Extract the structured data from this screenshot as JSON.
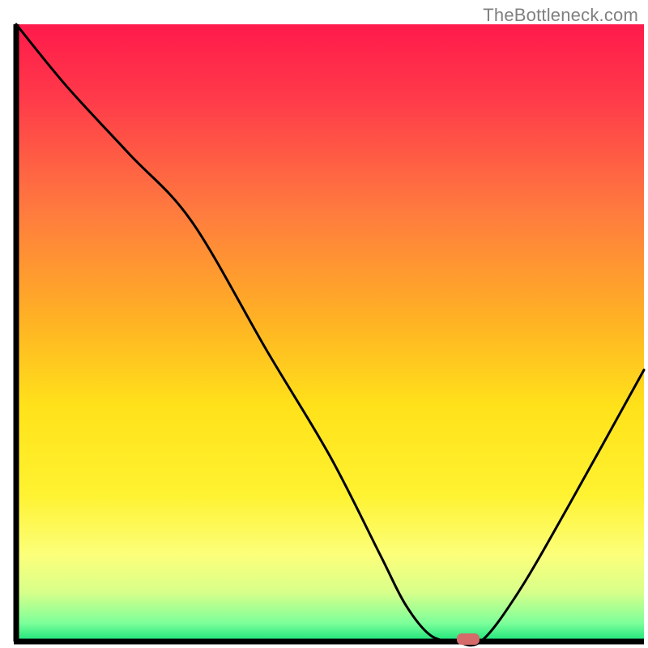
{
  "watermark": "TheBottleneck.com",
  "chart_data": {
    "type": "line",
    "title": "",
    "xlabel": "",
    "ylabel": "",
    "xlim": [
      0,
      100
    ],
    "ylim": [
      0,
      100
    ],
    "grid": false,
    "legend": false,
    "series": [
      {
        "name": "bottleneck-curve",
        "x": [
          0,
          8,
          18,
          28,
          40,
          50,
          58,
          62,
          66,
          70,
          74,
          80,
          88,
          100
        ],
        "values": [
          100,
          90,
          79,
          68,
          47,
          30,
          14,
          6,
          1,
          0,
          0,
          8,
          22,
          44
        ]
      }
    ],
    "marker": {
      "name": "optimal-point",
      "x": 72,
      "y": 0,
      "shape": "pill",
      "color": "#d46a6a"
    },
    "background": {
      "type": "vertical-gradient",
      "stops": [
        {
          "offset": 0.0,
          "color": "#ff1a4b"
        },
        {
          "offset": 0.12,
          "color": "#ff3a4a"
        },
        {
          "offset": 0.3,
          "color": "#ff7a3f"
        },
        {
          "offset": 0.48,
          "color": "#ffb224"
        },
        {
          "offset": 0.62,
          "color": "#ffe21a"
        },
        {
          "offset": 0.76,
          "color": "#fff230"
        },
        {
          "offset": 0.86,
          "color": "#fcff7a"
        },
        {
          "offset": 0.92,
          "color": "#d8ff8a"
        },
        {
          "offset": 0.97,
          "color": "#7dff9a"
        },
        {
          "offset": 1.0,
          "color": "#19e27a"
        }
      ]
    },
    "axes_color": "#000000",
    "line_color": "#000000",
    "line_width": 3
  }
}
